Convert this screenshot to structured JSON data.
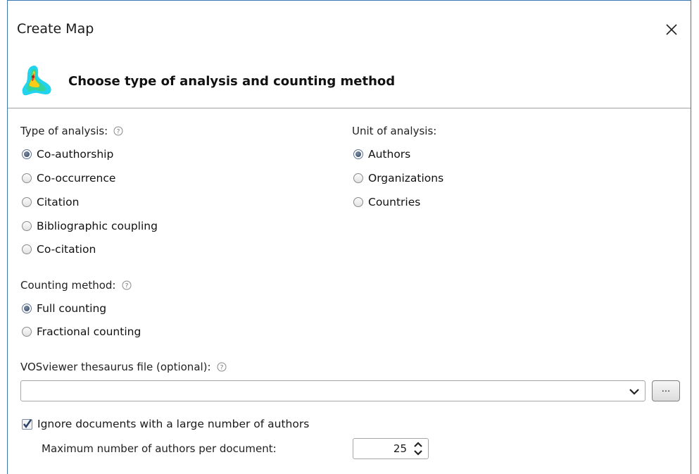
{
  "window": {
    "title": "Create Map"
  },
  "header": {
    "title": "Choose type of analysis and counting method"
  },
  "type_of_analysis": {
    "label": "Type of analysis:",
    "options": [
      "Co-authorship",
      "Co-occurrence",
      "Citation",
      "Bibliographic coupling",
      "Co-citation"
    ],
    "selected": "Co-authorship"
  },
  "unit_of_analysis": {
    "label": "Unit of analysis:",
    "options": [
      "Authors",
      "Organizations",
      "Countries"
    ],
    "selected": "Authors"
  },
  "counting_method": {
    "label": "Counting method:",
    "options": [
      "Full counting",
      "Fractional counting"
    ],
    "selected": "Full counting"
  },
  "thesaurus": {
    "label": "VOSviewer thesaurus file (optional):",
    "value": "",
    "browse_label": "..."
  },
  "ignore_documents": {
    "label": "Ignore documents with a large number of authors",
    "checked": true
  },
  "max_authors": {
    "label": "Maximum number of authors per document:",
    "value": "25"
  },
  "colors": {
    "accent": "#3c78b5",
    "radio_selected": "#2f3f59",
    "separator": "#a0a0a0"
  },
  "icons": {
    "close": "close-icon",
    "help": "help-icon",
    "logo": "vosviewer-logo-icon",
    "dropdown": "chevron-down-icon",
    "spinner": "spinner-arrows-icon"
  }
}
